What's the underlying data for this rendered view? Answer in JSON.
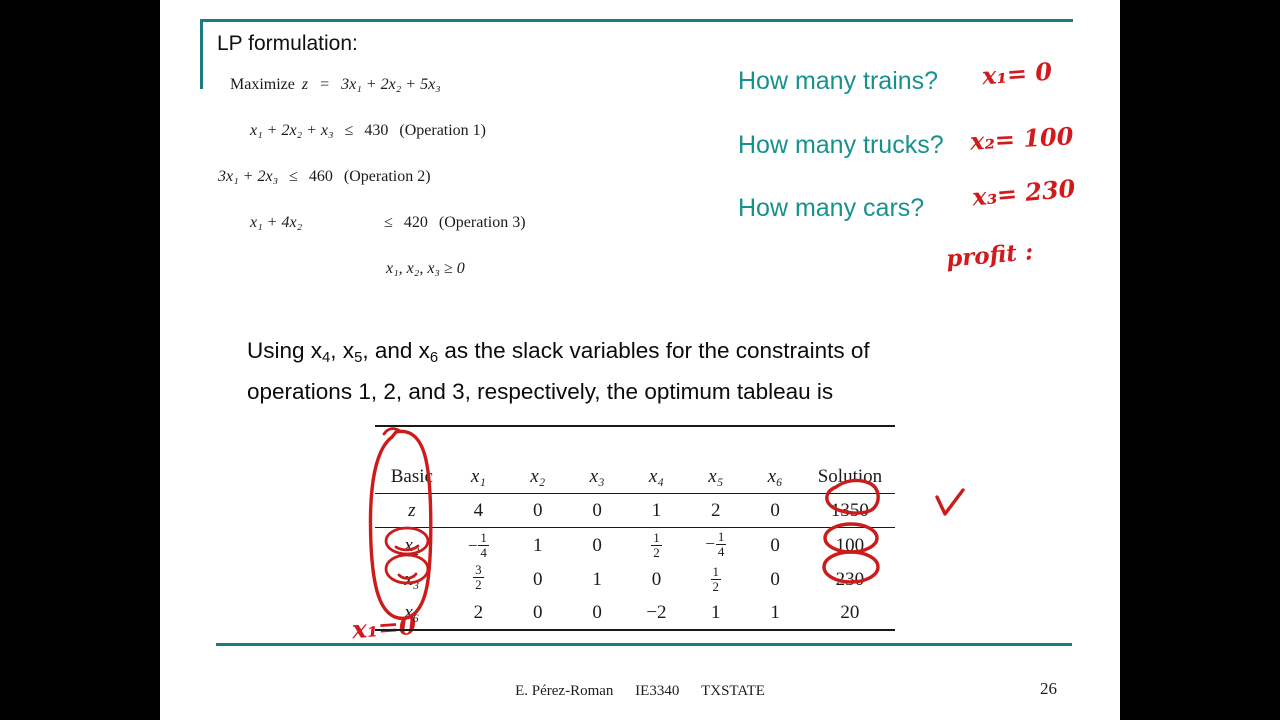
{
  "slide": {
    "lp_label": "LP formulation:",
    "accent_color": "#1a7b80",
    "ink_color": "#cc1b1b",
    "question_color": "#16918c"
  },
  "lp_formulation": {
    "objective": {
      "prefix": "Maximize",
      "expr_z": "z",
      "equals": "=",
      "terms": "3x₁ + 2x₂ + 5x₃"
    },
    "constraints": [
      {
        "lhs": "x₁ + 2x₂ +  x₃",
        "rel": "≤",
        "rhs": "430",
        "note": "(Operation 1)"
      },
      {
        "lhs": "3x₁        + 2x₃",
        "rel": "≤",
        "rhs": "460",
        "note": "(Operation 2)"
      },
      {
        "lhs": "x₁ + 4x₂",
        "rel": "≤",
        "rhs": "420",
        "note": "(Operation 3)"
      }
    ],
    "nonnegativity": "x₁, x₂, x₃ ≥ 0"
  },
  "questions": [
    {
      "label": "How many trains?",
      "answer": "x₁= 0"
    },
    {
      "label": "How many trucks?",
      "answer": "x₂= 100"
    },
    {
      "label": "How many cars?",
      "answer": "x₃= 230"
    }
  ],
  "annotations": {
    "profit": "profit :",
    "x1_bottom": "x₁=0",
    "checkmark": "check-mark",
    "basic_column_ellipse": "ellipse-around-basic-column",
    "circled_values": [
      "1350",
      "100",
      "230"
    ],
    "circled_basics": [
      "x₂",
      "x₃"
    ]
  },
  "body_text": {
    "line1_a": "Using x",
    "line1_sub1": "4",
    "line1_b": ", x",
    "line1_sub2": "5",
    "line1_c": ", and x",
    "line1_sub3": "6",
    "line1_d": " as the slack variables for the constraints of",
    "line2": "operations 1, 2, and 3, respectively, the optimum tableau is"
  },
  "tableau": {
    "headers": [
      "Basic",
      "x₁",
      "x₂",
      "x₃",
      "x₄",
      "x₅",
      "x₆",
      "Solution"
    ],
    "rows": [
      {
        "basic": "z",
        "cells": [
          "4",
          "0",
          "0",
          "1",
          "2",
          "0"
        ],
        "solution": "1350"
      },
      {
        "basic": "x₂",
        "cells": [
          "-1/4",
          "1",
          "0",
          "1/2",
          "-1/4",
          "0"
        ],
        "solution": "100"
      },
      {
        "basic": "x₃",
        "cells": [
          "3/2",
          "0",
          "1",
          "0",
          "1/2",
          "0"
        ],
        "solution": "230"
      },
      {
        "basic": "x₆",
        "cells": [
          "2",
          "0",
          "0",
          "−2",
          "1",
          "1"
        ],
        "solution": "20"
      }
    ]
  },
  "footer": {
    "author": "E. Pérez-Roman",
    "course": "IE3340",
    "school": "TXSTATE",
    "page": "26"
  }
}
